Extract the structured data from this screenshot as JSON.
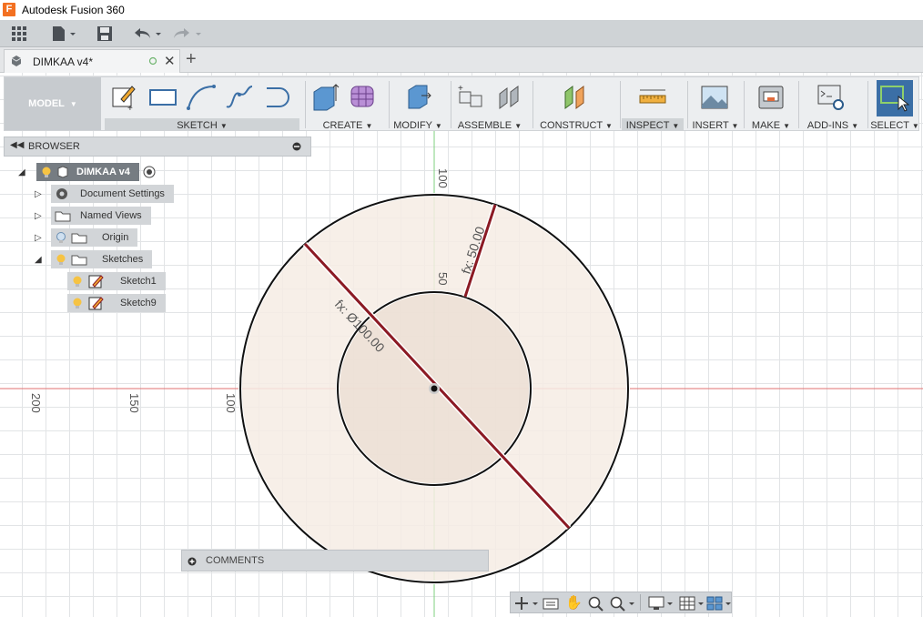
{
  "app": {
    "title": "Autodesk Fusion 360",
    "logo_letter": "F"
  },
  "document": {
    "tab_name": "DIMKAA v4*"
  },
  "workspace": {
    "label": "MODEL"
  },
  "toolbar": {
    "groups": [
      {
        "label": "SKETCH"
      },
      {
        "label": "CREATE"
      },
      {
        "label": "MODIFY"
      },
      {
        "label": "ASSEMBLE"
      },
      {
        "label": "CONSTRUCT"
      },
      {
        "label": "INSPECT"
      },
      {
        "label": "INSERT"
      },
      {
        "label": "MAKE"
      },
      {
        "label": "ADD-INS"
      },
      {
        "label": "SELECT"
      }
    ]
  },
  "browser": {
    "title": "BROWSER",
    "root": "DIMKAA v4",
    "items": [
      {
        "label": "Document Settings"
      },
      {
        "label": "Named Views"
      },
      {
        "label": "Origin"
      },
      {
        "label": "Sketches"
      },
      {
        "label": "Sketch1"
      },
      {
        "label": "Sketch9"
      }
    ]
  },
  "comments": {
    "label": "COMMENTS"
  },
  "canvas": {
    "ruler_top": [
      "100",
      "50"
    ],
    "ruler_left": [
      "200",
      "150",
      "100"
    ],
    "dim_radius": "fx: 50.00",
    "dim_diameter": "fx: Ø100.00"
  },
  "colors": {
    "accent_blue": "#4a7fb3",
    "select_active": "#3b6fa6",
    "dimension_line": "#8b1a24",
    "profile_fill": "#f6ece4"
  }
}
